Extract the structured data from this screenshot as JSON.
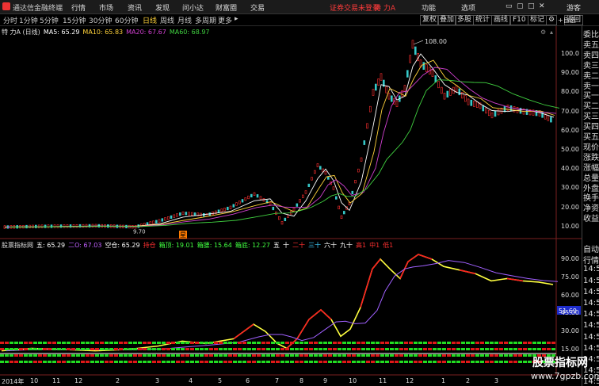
{
  "app": {
    "title": "通达信金融终端",
    "login_status": "证券交易未登录",
    "stock": "特 力A",
    "user_mode": "游客"
  },
  "menu": [
    "行情",
    "市场",
    "资讯",
    "发现",
    "问小达",
    "财富圈",
    "交易"
  ],
  "menu_right": [
    "功能",
    "选项"
  ],
  "periods": [
    "分时",
    "1分钟",
    "5分钟",
    "15分钟",
    "30分钟",
    "60分钟",
    "日线",
    "周线",
    "月线",
    "多周期",
    "更多"
  ],
  "active_period": "日线",
  "tools": [
    "复权",
    "叠加",
    "多股",
    "统计",
    "画线",
    "F10",
    "标记",
    "返回"
  ],
  "top_chart": {
    "legend": [
      {
        "label": "特 力A (日线)",
        "color": "#dddddd"
      },
      {
        "label": "MA5: 65.29",
        "color": "#ffffff"
      },
      {
        "label": "MA10: 65.83",
        "color": "#ffd23a"
      },
      {
        "label": "MA20: 67.67",
        "color": "#d040d0"
      },
      {
        "label": "MA60: 68.97",
        "color": "#40d040"
      }
    ],
    "axis_ticks": [
      "100.0",
      "90.00",
      "80.00",
      "70.00",
      "60.00",
      "50.00",
      "40.00",
      "30.00",
      "20.00",
      "10.00"
    ],
    "max_label": "108.00",
    "min_label": "9.70",
    "marker": "星"
  },
  "bottom_chart": {
    "legend": [
      {
        "label": "股票指标网",
        "color": "#dddddd"
      },
      {
        "label": "五: 65.29",
        "color": "#ffffff"
      },
      {
        "label": "二O: 67.03",
        "color": "#c060ff"
      },
      {
        "label": "空仓: 65.29",
        "color": "#ffffff"
      },
      {
        "label": "持仓",
        "color": "#ff3030"
      },
      {
        "label": "箱顶: 19.01",
        "color": "#40ff40"
      },
      {
        "label": "箱腰: 15.64",
        "color": "#40ff40"
      },
      {
        "label": "箱底: 12.27",
        "color": "#40ff40"
      },
      {
        "label": "五",
        "color": "#ffffff"
      },
      {
        "label": "十",
        "color": "#ffffff"
      },
      {
        "label": "二十",
        "color": "#ff3030"
      },
      {
        "label": "三十",
        "color": "#40d0ff"
      },
      {
        "label": "六十",
        "color": "#ffffff"
      },
      {
        "label": "九十",
        "color": "#ffffff"
      },
      {
        "label": "高1",
        "color": "#ff3030"
      },
      {
        "label": "中1",
        "color": "#ff3030"
      },
      {
        "label": "低1",
        "color": "#ff3030"
      }
    ],
    "axis_ticks": [
      "90.00",
      "75.00",
      "60.00",
      "45.00",
      "30.00",
      "15.00"
    ],
    "value_box": "51.69"
  },
  "x_axis": [
    "2014年",
    "10",
    "11",
    "12",
    "2",
    "3",
    "4",
    "5",
    "6",
    "7",
    "8",
    "9",
    "10",
    "11",
    "12",
    "1",
    "2",
    "3"
  ],
  "right_panel": {
    "top": [
      "委比",
      "卖五",
      "卖四",
      "卖三",
      "卖二",
      "卖一",
      "买一",
      "买二",
      "买三",
      "买四",
      "买五",
      "现价",
      "涨跌",
      "涨幅",
      "总量",
      "外盘",
      "换手",
      "净资",
      "收益"
    ],
    "bottom": [
      "自动",
      "行情",
      "14:50",
      "14:50",
      "14:50",
      "14:50",
      "14:50",
      "14:50",
      "14:50",
      "14:50",
      "14:50",
      "14:50",
      "14:50"
    ],
    "add_watch": "+自选"
  },
  "watermark": {
    "title": "股票指标网",
    "url": "www.7gpzb.com"
  }
}
